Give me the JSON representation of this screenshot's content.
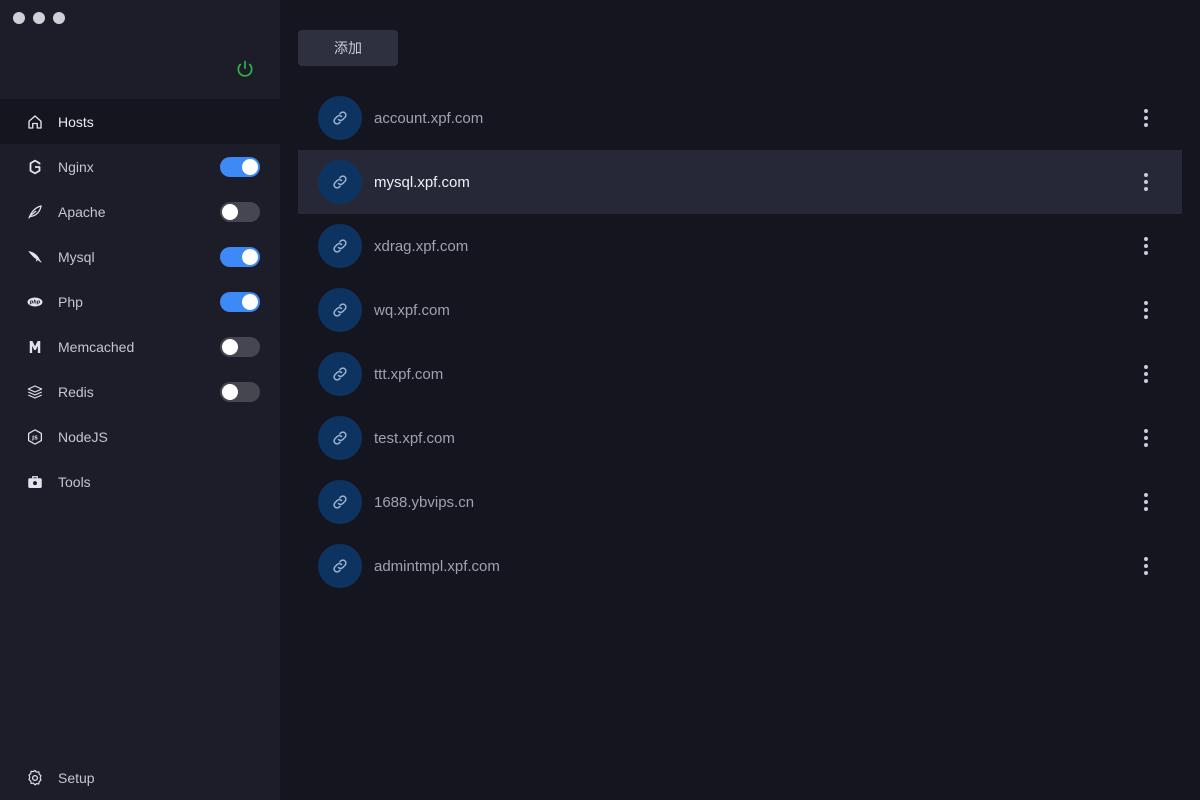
{
  "colors": {
    "accent": "#3d8af7",
    "power_on": "#2eb84b",
    "link_circle": "#0d3461"
  },
  "add_button_label": "添加",
  "sidebar": {
    "power_icon": "power-icon",
    "items": [
      {
        "id": "hosts",
        "label": "Hosts",
        "icon": "home-icon",
        "active": true,
        "toggle": null
      },
      {
        "id": "nginx",
        "label": "Nginx",
        "icon": "nginx-icon",
        "toggle": true
      },
      {
        "id": "apache",
        "label": "Apache",
        "icon": "apache-feather-icon",
        "toggle": false
      },
      {
        "id": "mysql",
        "label": "Mysql",
        "icon": "mysql-dolphin-icon",
        "toggle": true
      },
      {
        "id": "php",
        "label": "Php",
        "icon": "php-icon",
        "toggle": true
      },
      {
        "id": "memcached",
        "label": "Memcached",
        "icon": "memcached-icon",
        "toggle": false
      },
      {
        "id": "redis",
        "label": "Redis",
        "icon": "redis-icon",
        "toggle": false
      },
      {
        "id": "nodejs",
        "label": "NodeJS",
        "icon": "nodejs-icon",
        "toggle": null
      },
      {
        "id": "tools",
        "label": "Tools",
        "icon": "toolbox-icon",
        "toggle": null
      }
    ],
    "setup_label": "Setup",
    "setup_icon": "gear-icon"
  },
  "hosts": [
    {
      "name": "account.xpf.com",
      "selected": false
    },
    {
      "name": "mysql.xpf.com",
      "selected": true
    },
    {
      "name": "xdrag.xpf.com",
      "selected": false
    },
    {
      "name": "wq.xpf.com",
      "selected": false
    },
    {
      "name": "ttt.xpf.com",
      "selected": false
    },
    {
      "name": "test.xpf.com",
      "selected": false
    },
    {
      "name": "1688.ybvips.cn",
      "selected": false
    },
    {
      "name": "admintmpl.xpf.com",
      "selected": false
    }
  ]
}
